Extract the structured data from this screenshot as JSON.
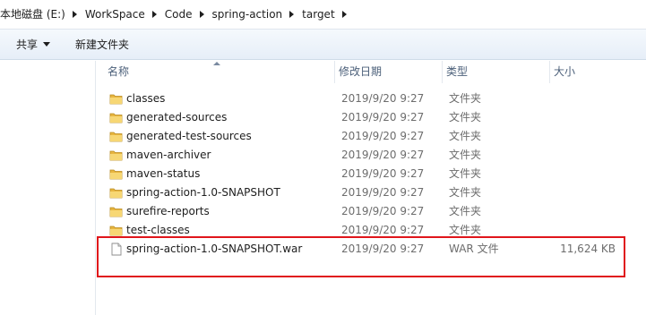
{
  "breadcrumb": [
    "本地磁盘 (E:)",
    "WorkSpace",
    "Code",
    "spring-action",
    "target"
  ],
  "toolbar": {
    "share_label": "共享",
    "new_folder_label": "新建文件夹"
  },
  "columns": {
    "name": "名称",
    "date": "修改日期",
    "type": "类型",
    "size": "大小"
  },
  "files": [
    {
      "name": "classes",
      "date": "2019/9/20 9:27",
      "type": "文件夹",
      "size": "",
      "icon": "folder-icon"
    },
    {
      "name": "generated-sources",
      "date": "2019/9/20 9:27",
      "type": "文件夹",
      "size": "",
      "icon": "folder-icon"
    },
    {
      "name": "generated-test-sources",
      "date": "2019/9/20 9:27",
      "type": "文件夹",
      "size": "",
      "icon": "folder-icon"
    },
    {
      "name": "maven-archiver",
      "date": "2019/9/20 9:27",
      "type": "文件夹",
      "size": "",
      "icon": "folder-icon"
    },
    {
      "name": "maven-status",
      "date": "2019/9/20 9:27",
      "type": "文件夹",
      "size": "",
      "icon": "folder-icon"
    },
    {
      "name": "spring-action-1.0-SNAPSHOT",
      "date": "2019/9/20 9:27",
      "type": "文件夹",
      "size": "",
      "icon": "folder-icon"
    },
    {
      "name": "surefire-reports",
      "date": "2019/9/20 9:27",
      "type": "文件夹",
      "size": "",
      "icon": "folder-icon"
    },
    {
      "name": "test-classes",
      "date": "2019/9/20 9:27",
      "type": "文件夹",
      "size": "",
      "icon": "folder-icon"
    },
    {
      "name": "spring-action-1.0-SNAPSHOT.war",
      "date": "2019/9/20 9:27",
      "type": "WAR 文件",
      "size": "11,624 KB",
      "icon": "file-icon"
    }
  ],
  "highlight_color": "#e0161b"
}
